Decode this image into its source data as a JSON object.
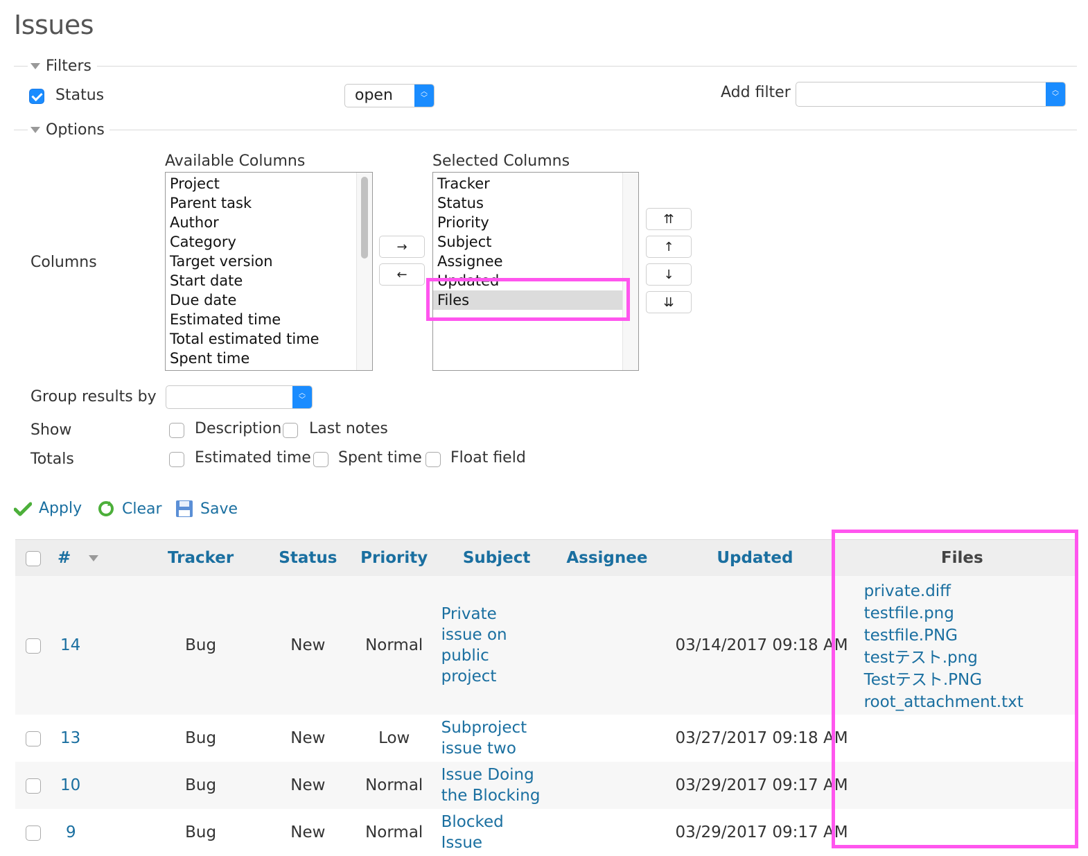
{
  "page_title": "Issues",
  "filters": {
    "legend": "Filters",
    "status_label": "Status",
    "status_checked": true,
    "status_operator": "open",
    "add_filter_label": "Add filter",
    "add_filter_value": ""
  },
  "options": {
    "legend": "Options",
    "columns_label": "Columns",
    "available_title": "Available Columns",
    "available": [
      "Project",
      "Parent task",
      "Author",
      "Category",
      "Target version",
      "Start date",
      "Due date",
      "Estimated time",
      "Total estimated time",
      "Spent time"
    ],
    "selected_title": "Selected Columns",
    "selected": [
      "Tracker",
      "Status",
      "Priority",
      "Subject",
      "Assignee",
      "Updated",
      "Files"
    ],
    "selected_highlighted": "Files",
    "move_right": "→",
    "move_left": "←",
    "move_top": "⇈",
    "move_up": "↑",
    "move_down": "↓",
    "move_bottom": "⇊",
    "group_by_label": "Group results by",
    "group_by_value": "",
    "show_label": "Show",
    "show_options": [
      "Description",
      "Last notes"
    ],
    "totals_label": "Totals",
    "totals_options": [
      "Estimated time",
      "Spent time",
      "Float field"
    ]
  },
  "actions": {
    "apply": "Apply",
    "clear": "Clear",
    "save": "Save"
  },
  "table": {
    "headers": [
      "#",
      "Tracker",
      "Status",
      "Priority",
      "Subject",
      "Assignee",
      "Updated",
      "Files"
    ],
    "rows": [
      {
        "id": "14",
        "tracker": "Bug",
        "status": "New",
        "priority": "Normal",
        "subject": "Private issue on public project",
        "assignee": "",
        "updated": "03/14/2017 09:18 AM",
        "files": [
          "private.diff",
          "testfile.png",
          "testfile.PNG",
          "testテスト.png",
          "Testテスト.PNG",
          "root_attachment.txt"
        ]
      },
      {
        "id": "13",
        "tracker": "Bug",
        "status": "New",
        "priority": "Low",
        "subject": "Subproject issue two",
        "assignee": "",
        "updated": "03/27/2017 09:18 AM",
        "files": []
      },
      {
        "id": "10",
        "tracker": "Bug",
        "status": "New",
        "priority": "Normal",
        "subject": "Issue Doing the Blocking",
        "assignee": "",
        "updated": "03/29/2017 09:17 AM",
        "files": []
      },
      {
        "id": "9",
        "tracker": "Bug",
        "status": "New",
        "priority": "Normal",
        "subject": "Blocked Issue",
        "assignee": "",
        "updated": "03/29/2017 09:17 AM",
        "files": []
      }
    ]
  },
  "colors": {
    "link": "#1a6fa0",
    "highlight": "#ff55ee",
    "select_accent": "#1a8cff",
    "header_bg": "#eeeeee"
  }
}
